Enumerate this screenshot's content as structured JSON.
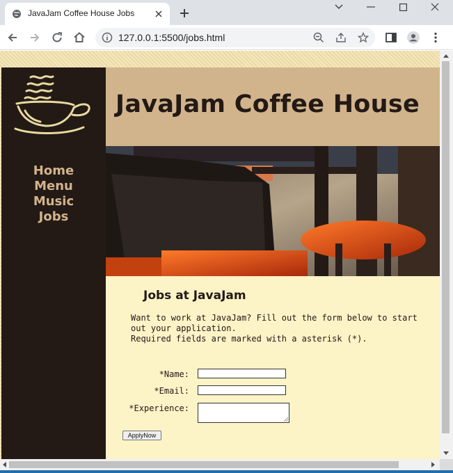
{
  "browser": {
    "tab_title": "JavaJam Coffee House Jobs",
    "url": "127.0.0.1:5500/jobs.html"
  },
  "page": {
    "site_title": "JavaJam Coffee House",
    "nav": [
      "Home",
      "Menu",
      "Music",
      "Jobs"
    ],
    "heading": "Jobs at JavaJam",
    "intro_line1": "Want to work at JavaJam? Fill out the form below to start out your application.",
    "intro_line2": "Required fields are marked with a asterisk (*).",
    "form": {
      "name_label": "*Name:",
      "email_label": "*Email:",
      "experience_label": "*Experience:",
      "name_value": "",
      "email_value": "",
      "experience_value": "",
      "submit_label": "ApplyNow"
    }
  },
  "colors": {
    "dark_brown": "#231915",
    "tan": "#d2b48c",
    "cream": "#fcf3c7"
  }
}
